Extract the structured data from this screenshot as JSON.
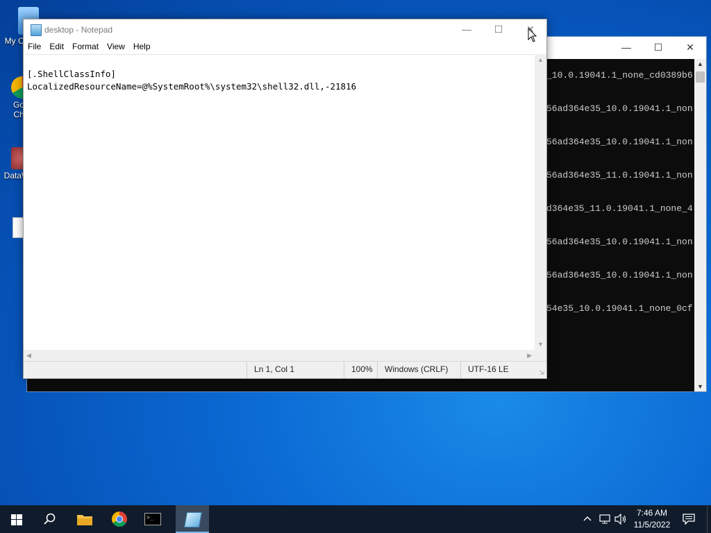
{
  "desktop": {
    "icons": [
      {
        "label": "My Co"
      },
      {
        "label": "Go\nCh"
      },
      {
        "label": "DataW"
      }
    ]
  },
  "console": {
    "lines": [
      "_10.0.19041.1_none_cd0389b6",
      "56ad364e35_10.0.19041.1_non",
      "56ad364e35_10.0.19041.1_non",
      "56ad364e35_11.0.19041.1_non",
      "d364e35_11.0.19041.1_none_4",
      "56ad364e35_10.0.19041.1_non",
      "56ad364e35_10.0.19041.1_non",
      "54e35_10.0.19041.1_none_0cf"
    ]
  },
  "notepad": {
    "title": "desktop - Notepad",
    "menu": [
      "File",
      "Edit",
      "Format",
      "View",
      "Help"
    ],
    "content_line1": "[.ShellClassInfo]",
    "content_line2": "LocalizedResourceName=@%SystemRoot%\\system32\\shell32.dll,-21816",
    "status": {
      "position": "Ln 1, Col 1",
      "zoom": "100%",
      "line_ending": "Windows (CRLF)",
      "encoding": "UTF-16 LE"
    }
  },
  "taskbar": {
    "time": "7:46 AM",
    "date": "11/5/2022"
  },
  "icons": {
    "start": "windows-logo-icon",
    "search": "search-icon",
    "explorer": "folder-icon",
    "chrome": "chrome-icon",
    "terminal": "cmd-icon",
    "notepad": "notepad-icon"
  },
  "colors": {
    "taskbar": "#101c2c",
    "accent": "#76b9ed",
    "desktop": "#0b6ad4"
  }
}
